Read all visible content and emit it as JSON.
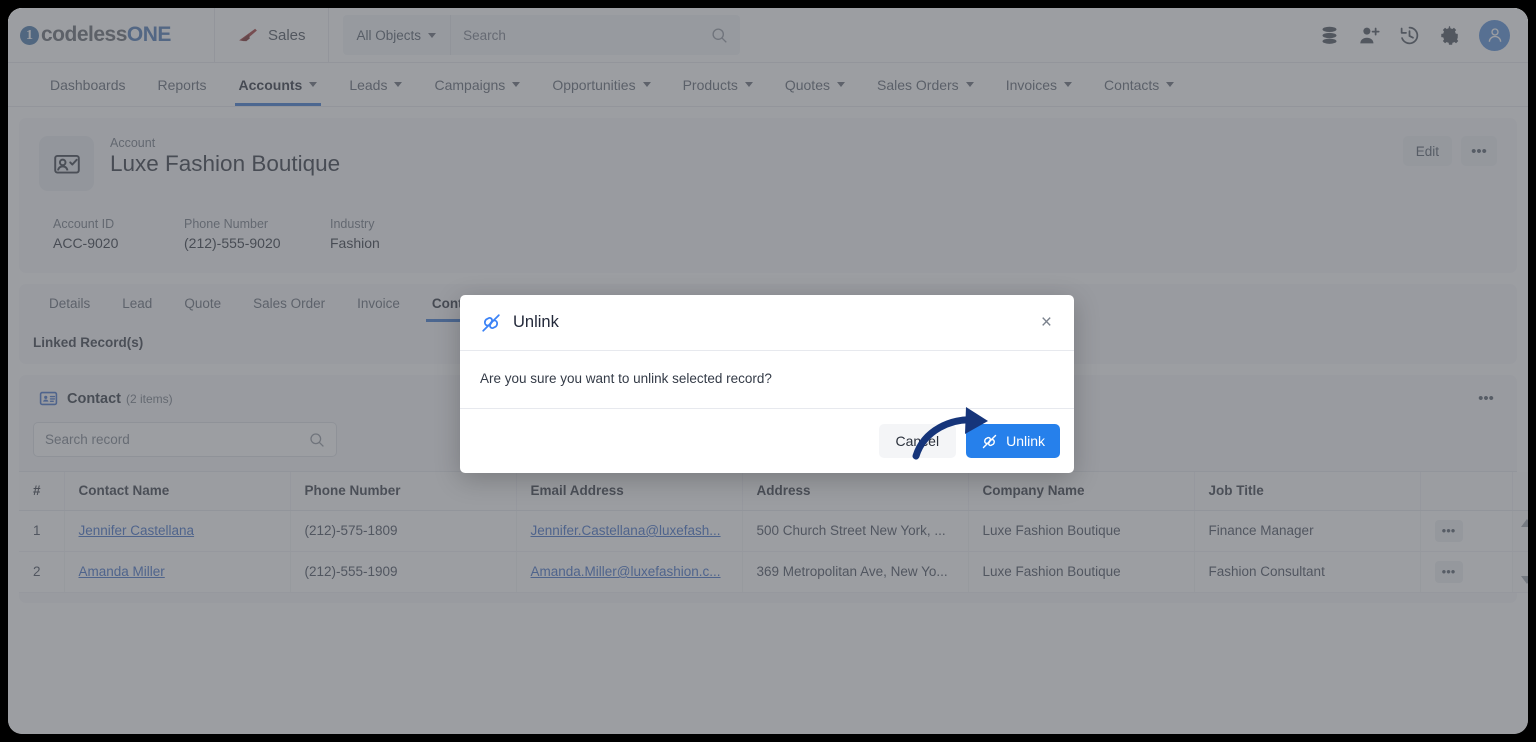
{
  "topbar": {
    "logo_text_a": "codeless",
    "logo_text_b": "ONE",
    "logo_mark": "1",
    "app_name": "Sales",
    "app_icon": "sales-triangle-icon",
    "object_selector": "All Objects",
    "search_placeholder": "Search",
    "search_value": "",
    "icons": [
      {
        "name": "database-icon"
      },
      {
        "name": "add-user-icon"
      },
      {
        "name": "history-icon"
      },
      {
        "name": "gear-icon"
      },
      {
        "name": "avatar-icon"
      }
    ]
  },
  "mainnav": [
    {
      "label": "Dashboards",
      "caret": false,
      "active": false
    },
    {
      "label": "Reports",
      "caret": false,
      "active": false
    },
    {
      "label": "Accounts",
      "caret": true,
      "active": true
    },
    {
      "label": "Leads",
      "caret": true,
      "active": false
    },
    {
      "label": "Campaigns",
      "caret": true,
      "active": false
    },
    {
      "label": "Opportunities",
      "caret": true,
      "active": false
    },
    {
      "label": "Products",
      "caret": true,
      "active": false
    },
    {
      "label": "Quotes",
      "caret": true,
      "active": false
    },
    {
      "label": "Sales Orders",
      "caret": true,
      "active": false
    },
    {
      "label": "Invoices",
      "caret": true,
      "active": false
    },
    {
      "label": "Contacts",
      "caret": true,
      "active": false
    }
  ],
  "record": {
    "kind": "Account",
    "title": "Luxe Fashion Boutique",
    "icon": "account-card-check-icon",
    "edit_label": "Edit",
    "more_label": "•••",
    "fields": [
      {
        "label": "Account ID",
        "value": "ACC-9020"
      },
      {
        "label": "Phone Number",
        "value": "(212)-555-9020"
      },
      {
        "label": "Industry",
        "value": "Fashion"
      }
    ]
  },
  "tabs": {
    "items": [
      {
        "label": "Details",
        "active": false
      },
      {
        "label": "Lead",
        "active": false
      },
      {
        "label": "Quote",
        "active": false
      },
      {
        "label": "Sales Order",
        "active": false
      },
      {
        "label": "Invoice",
        "active": false
      },
      {
        "label": "Contact",
        "active": true
      }
    ],
    "linked_records_label": "Linked Record(s)"
  },
  "panel": {
    "icon": "contact-card-icon",
    "title": "Contact",
    "count": "(2 items)",
    "more_label": "•••",
    "search_placeholder": "Search record",
    "search_value": ""
  },
  "table": {
    "columns": [
      "#",
      "Contact Name",
      "Phone Number",
      "Email Address",
      "Address",
      "Company Name",
      "Job Title"
    ],
    "rows": [
      {
        "index": "1",
        "name": "Jennifer Castellana",
        "phone": "(212)-575-1809",
        "email": "Jennifer.Castellana@luxefash...",
        "address": "500 Church Street New York, ...",
        "company": "Luxe Fashion Boutique",
        "job": "Finance Manager",
        "actions": "•••"
      },
      {
        "index": "2",
        "name": "Amanda Miller",
        "phone": "(212)-555-1909",
        "email": "Amanda.Miller@luxefashion.c...",
        "address": "369 Metropolitan Ave, New Yo...",
        "company": "Luxe Fashion Boutique",
        "job": "Fashion Consultant",
        "actions": "•••"
      }
    ]
  },
  "modal": {
    "icon": "unlink-icon",
    "title": "Unlink",
    "close_label": "×",
    "message": "Are you sure you want to unlink selected record?",
    "cancel_label": "Cancel",
    "confirm_label": "Unlink"
  },
  "colors": {
    "accent_blue": "#2680eb",
    "nav_active": "#2f6fd0",
    "link_blue": "#3566c4",
    "logo_blue": "#3f6fb0",
    "sales_red": "#9e2a2a",
    "annotation_arrow": "#16357a"
  }
}
